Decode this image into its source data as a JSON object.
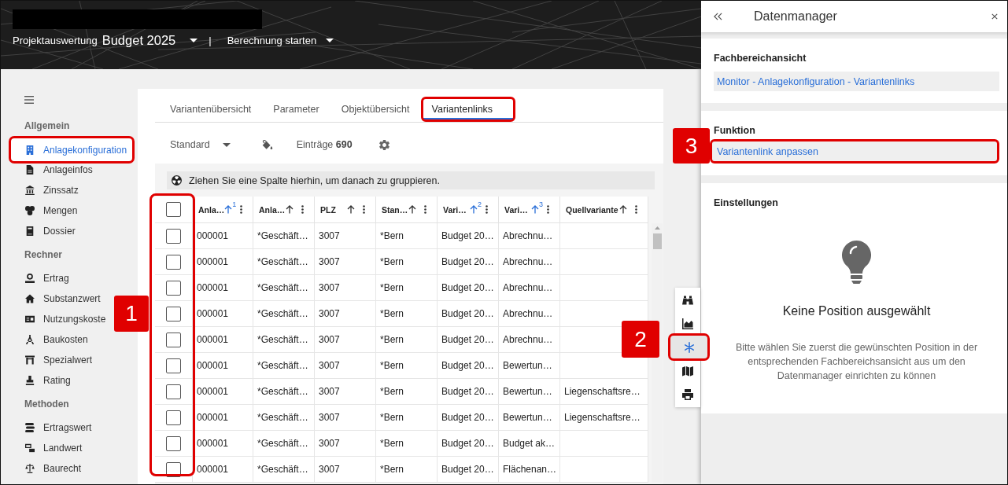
{
  "header": {
    "project_label": "Projektauswertung",
    "project_name": "Budget 2025",
    "separator": "|",
    "action": "Berechnung starten"
  },
  "sidebar": {
    "sections": [
      {
        "title": "Allgemein",
        "items": [
          {
            "label": "Anlagekonfiguration",
            "selected": true,
            "highlighted": true
          },
          {
            "label": "Anlageinfos",
            "selected": false,
            "highlighted": false
          },
          {
            "label": "Zinssatz",
            "selected": false,
            "highlighted": false
          },
          {
            "label": "Mengen",
            "selected": false,
            "highlighted": false
          },
          {
            "label": "Dossier",
            "selected": false,
            "highlighted": false
          }
        ]
      },
      {
        "title": "Rechner",
        "items": [
          {
            "label": "Ertrag",
            "selected": false,
            "highlighted": false
          },
          {
            "label": "Substanzwert",
            "selected": false,
            "highlighted": false
          },
          {
            "label": "Nutzungskoste",
            "selected": false,
            "highlighted": false
          },
          {
            "label": "Baukosten",
            "selected": false,
            "highlighted": false
          },
          {
            "label": "Spezialwert",
            "selected": false,
            "highlighted": false
          },
          {
            "label": "Rating",
            "selected": false,
            "highlighted": false
          }
        ]
      },
      {
        "title": "Methoden",
        "items": [
          {
            "label": "Ertragswert",
            "selected": false,
            "highlighted": false
          },
          {
            "label": "Landwert",
            "selected": false,
            "highlighted": false
          },
          {
            "label": "Baurecht",
            "selected": false,
            "highlighted": false
          }
        ]
      }
    ]
  },
  "tabs": [
    {
      "label": "Variantenübersicht",
      "selected": false,
      "highlighted": false
    },
    {
      "label": "Parameter",
      "selected": false,
      "highlighted": false
    },
    {
      "label": "Objektübersicht",
      "selected": false,
      "highlighted": false
    },
    {
      "label": "Variantenlinks",
      "selected": true,
      "highlighted": true
    }
  ],
  "toolbar": {
    "view": "Standard",
    "entries": "Einträge **690**"
  },
  "group_panel": {
    "hint": "Ziehen Sie eine Spalte hierhin, um danach zu gruppieren."
  },
  "table": {
    "select_all": {
      "checked": false
    },
    "checkbox_column": {
      "highlighted": true,
      "marker": "1"
    },
    "columns": [
      {
        "label": "Anla…",
        "sorted": true,
        "sort_rank": "1"
      },
      {
        "label": "Anla…",
        "sorted": false
      },
      {
        "label": "PLZ",
        "sorted": false
      },
      {
        "label": "Stan…",
        "sorted": false
      },
      {
        "label": "Vari…",
        "sorted": true,
        "sort_rank": "2"
      },
      {
        "label": "Vari…",
        "sorted": true,
        "sort_rank": "3"
      },
      {
        "label": "Quellvariante",
        "sorted": false
      }
    ],
    "rows": [
      {
        "checked": false,
        "cells": [
          "000001",
          "*Geschäft…",
          "3007",
          "*Bern",
          "Budget 20…",
          "Abrechnu…"
        ]
      },
      {
        "checked": false,
        "cells": [
          "000001",
          "*Geschäft…",
          "3007",
          "*Bern",
          "Budget 20…",
          "Abrechnu…"
        ]
      },
      {
        "checked": false,
        "cells": [
          "000001",
          "*Geschäft…",
          "3007",
          "*Bern",
          "Budget 20…",
          "Abrechnu…"
        ]
      },
      {
        "checked": false,
        "cells": [
          "000001",
          "*Geschäft…",
          "3007",
          "*Bern",
          "Budget 20…",
          "Abrechnu…"
        ]
      },
      {
        "checked": false,
        "cells": [
          "000001",
          "*Geschäft…",
          "3007",
          "*Bern",
          "Budget 20…",
          "Abrechnu…"
        ]
      },
      {
        "checked": false,
        "cells": [
          "000001",
          "*Geschäft…",
          "3007",
          "*Bern",
          "Budget 20…",
          "Bewertun…"
        ]
      },
      {
        "checked": false,
        "cells": [
          "000001",
          "*Geschäft…",
          "3007",
          "*Bern",
          "Budget 20…",
          "Bewertun…",
          "Liegenschaftsre…"
        ]
      },
      {
        "checked": false,
        "cells": [
          "000001",
          "*Geschäft…",
          "3007",
          "*Bern",
          "Budget 20…",
          "Bewertun…",
          "Liegenschaftsre…"
        ]
      },
      {
        "checked": false,
        "cells": [
          "000001",
          "*Geschäft…",
          "3007",
          "*Bern",
          "Budget 20…",
          "Budget ak…"
        ]
      },
      {
        "checked": false,
        "cells": [
          "000001",
          "*Geschäft…",
          "3007",
          "*Bern",
          "Budget 20…",
          "Flächenan…"
        ]
      }
    ]
  },
  "side_tools": [
    {
      "selected": false,
      "highlighted": false
    },
    {
      "selected": false,
      "highlighted": false
    },
    {
      "selected": true,
      "highlighted": true,
      "marker": "2"
    },
    {
      "selected": false,
      "highlighted": false
    },
    {
      "selected": false,
      "highlighted": false
    }
  ],
  "panel": {
    "title": "Datenmanager",
    "sections": [
      {
        "kind": "link",
        "heading": "Fachbereichansicht",
        "link": "Monitor - Anlagekonfiguration - Variantenlinks",
        "highlighted": false
      },
      {
        "kind": "link",
        "heading": "Funktion",
        "link": "Variantenlink anpassen",
        "highlighted": true,
        "marker": "3"
      },
      {
        "kind": "empty",
        "heading": "Einstellungen",
        "empty_title": "Keine Position ausgewählt",
        "empty_text": "Bitte wählen Sie zuerst die gewünschten Position in der entsprechenden Fachbereichsansicht aus um den Datenmanager einrichten zu können"
      }
    ]
  }
}
